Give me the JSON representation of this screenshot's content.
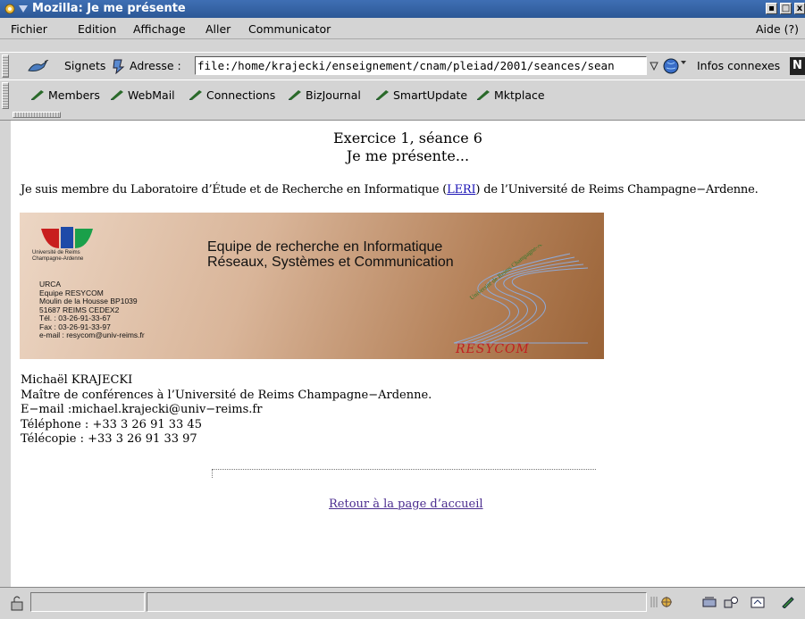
{
  "window": {
    "title": "Mozilla: Je me présente"
  },
  "menu": {
    "items": [
      "Fichier",
      "Edition",
      "Affichage",
      "Aller",
      "Communicator"
    ],
    "help": "Aide (?)"
  },
  "navbar": {
    "bookmarks_label": "Signets",
    "address_label": "Adresse :",
    "url": "file:/home/krajecki/enseignement/cnam/pleiad/2001/seances/sean",
    "related_label": "Infos connexes"
  },
  "personal_toolbar": {
    "items": [
      "Members",
      "WebMail",
      "Connections",
      "BizJournal",
      "SmartUpdate",
      "Mktplace"
    ]
  },
  "page": {
    "heading_line1": "Exercice 1, séance 6",
    "heading_line2": "Je me présente...",
    "intro_before": "Je suis membre du Laboratoire d’Étude et de Recherche en Informatique (",
    "intro_link": "LERI",
    "intro_after": ") de l’Université de Reims Champagne−Ardenne.",
    "banner": {
      "university": "Université de Reims Champagne-Ardenne",
      "title_line1": "Equipe de recherche en Informatique",
      "title_line2": "Réseaux, Systèmes et Communication",
      "address_lines": [
        "URCA",
        "Equipe RESYCOM",
        "Moulin de la Housse BP1039",
        "51687 REIMS CEDEX2",
        "Tél. : 03-26-91-33-67",
        "Fax : 03-26-91-33-97",
        "e-mail : resycom@univ-reims.fr"
      ],
      "logo_text": "RESYCOM",
      "curve_text": "Université de Reims Champagne-Ardenne"
    },
    "info_lines": [
      "Michaël KRAJECKI",
      "Maître de conférences à l’Université de Reims Champagne−Ardenne.",
      "E−mail :michael.krajecki@univ−reims.fr",
      "Téléphone : +33 3 26 91 33 45",
      "Télécopie : +33 3 26 91 33 97"
    ],
    "back_link": "Retour à la page d’accueil"
  },
  "colors": {
    "titlebar": "#3563a8",
    "link": "#1a12b5",
    "visited": "#4b2d8f",
    "chrome": "#d4d4d4"
  }
}
